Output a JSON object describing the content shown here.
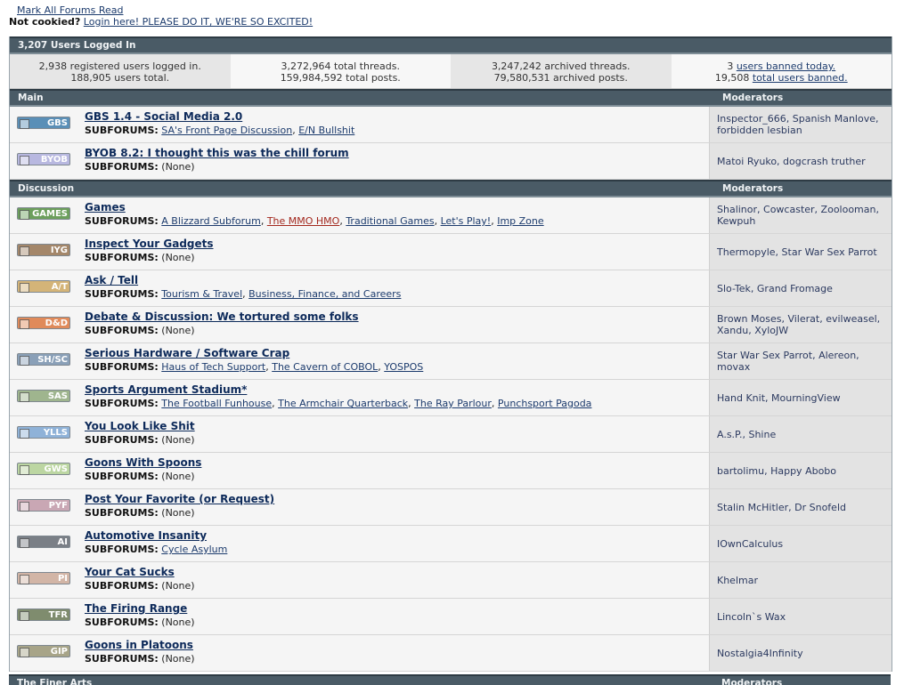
{
  "top": {
    "mark_all": "Mark All Forums Read",
    "not_cookied": "Not cookied?",
    "login": "Login here! PLEASE DO IT, WE'RE SO EXCITED!"
  },
  "users_header": "3,207 Users Logged In",
  "stats": [
    [
      "2,938 registered users logged in.",
      "188,905 users total."
    ],
    [
      "3,272,964 total threads.",
      "159,984,592 total posts."
    ],
    [
      "3,247,242 archived threads.",
      "79,580,531 archived posts."
    ]
  ],
  "bans": {
    "count_today": "3",
    "today_link": "users banned today.",
    "total": "19,508",
    "total_link": "total users banned."
  },
  "subforums_label": "SUBFORUMS:",
  "none": "(None)",
  "sections": [
    {
      "title": "Main",
      "mods_label": "Moderators",
      "forums": [
        {
          "badge": "GBS",
          "color": "#5a8fb7",
          "title": "GBS 1.4 - Social Media 2.0",
          "subs": [
            "SA's Front Page Discussion",
            "E/N Bullshit"
          ],
          "mods": "Inspector_666, Spanish Manlove, forbidden lesbian"
        },
        {
          "badge": "BYOB",
          "color": "#b8b8e0",
          "title": "BYOB 8.2: I thought this was the chill forum",
          "subs": [],
          "mods": "Matoi Ryuko, dogcrash truther"
        }
      ]
    },
    {
      "title": "Discussion",
      "mods_label": "Moderators",
      "forums": [
        {
          "badge": "GAMES",
          "color": "#6c9f5c",
          "title": "Games",
          "subs": [
            "A Blizzard Subforum",
            "The MMO HMO",
            "Traditional Games",
            "Let's Play!",
            "Imp Zone"
          ],
          "red_sub": 1,
          "mods": "Shalinor, Cowcaster, Zoolooman, Kewpuh"
        },
        {
          "badge": "IYG",
          "color": "#a4876a",
          "title": "Inspect Your Gadgets",
          "subs": [],
          "mods": "Thermopyle, Star War Sex Parrot"
        },
        {
          "badge": "A/T",
          "color": "#d4b478",
          "title": "Ask / Tell",
          "subs": [
            "Tourism & Travel",
            "Business, Finance, and Careers"
          ],
          "mods": "Slo-Tek, Grand Fromage"
        },
        {
          "badge": "D&D",
          "color": "#e08a5a",
          "title": "Debate & Discussion: We tortured some folks",
          "subs": [],
          "mods": "Brown Moses, Vilerat, evilweasel, Xandu, XyloJW"
        },
        {
          "badge": "SH/SC",
          "color": "#8aa0b8",
          "title": "Serious Hardware / Software Crap",
          "subs": [
            "Haus of Tech Support",
            "The Cavern of COBOL",
            "YOSPOS"
          ],
          "mods": "Star War Sex Parrot, Alereon, movax"
        },
        {
          "badge": "SAS",
          "color": "#9fb58e",
          "title": "Sports Argument Stadium*",
          "subs": [
            "The Football Funhouse",
            "The Armchair Quarterback",
            "The Ray Parlour",
            "Punchsport Pagoda"
          ],
          "mods": "Hand Knit, MourningView"
        },
        {
          "badge": "YLLS",
          "color": "#8fb2d8",
          "title": "You Look Like Shit",
          "subs": [],
          "mods": "A.s.P., Shine"
        },
        {
          "badge": "GWS",
          "color": "#bcd6a2",
          "title": "Goons With Spoons",
          "subs": [],
          "mods": "bartolimu, Happy Abobo"
        },
        {
          "badge": "PYF",
          "color": "#c9a7b4",
          "title": "Post Your Favorite (or Request)",
          "subs": [],
          "mods": "Stalin McHitler, Dr Snofeld"
        },
        {
          "badge": "AI",
          "color": "#7a7f86",
          "title": "Automotive Insanity",
          "subs": [
            "Cycle Asylum"
          ],
          "mods": "IOwnCalculus"
        },
        {
          "badge": "PI",
          "color": "#d2b5a6",
          "title": "Your Cat Sucks",
          "subs": [],
          "mods": "Khelmar"
        },
        {
          "badge": "TFR",
          "color": "#7f8c6e",
          "title": "The Firing Range",
          "subs": [],
          "mods": "Lincoln`s Wax"
        },
        {
          "badge": "GIP",
          "color": "#a7a488",
          "title": "Goons in Platoons",
          "subs": [],
          "mods": "Nostalgia4Infinity"
        }
      ]
    }
  ],
  "next_section": {
    "title": "The Finer Arts",
    "mods_label": "Moderators"
  }
}
